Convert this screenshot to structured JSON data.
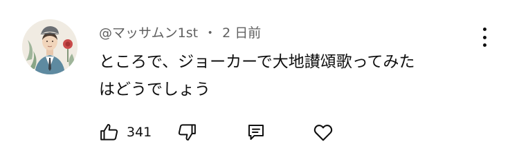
{
  "comment": {
    "author": "@マッサムン1st",
    "separator": "・",
    "time": "2 日前",
    "text_lines": [
      "ところで、ジョーカーで大地讃頌歌ってみた",
      "はどうでしょう"
    ],
    "like_count": "341"
  },
  "icons": {
    "like": "thumbs-up-icon",
    "dislike": "thumbs-down-icon",
    "reply": "reply-comment-icon",
    "heart": "heart-icon",
    "more": "more-vertical-icon"
  }
}
